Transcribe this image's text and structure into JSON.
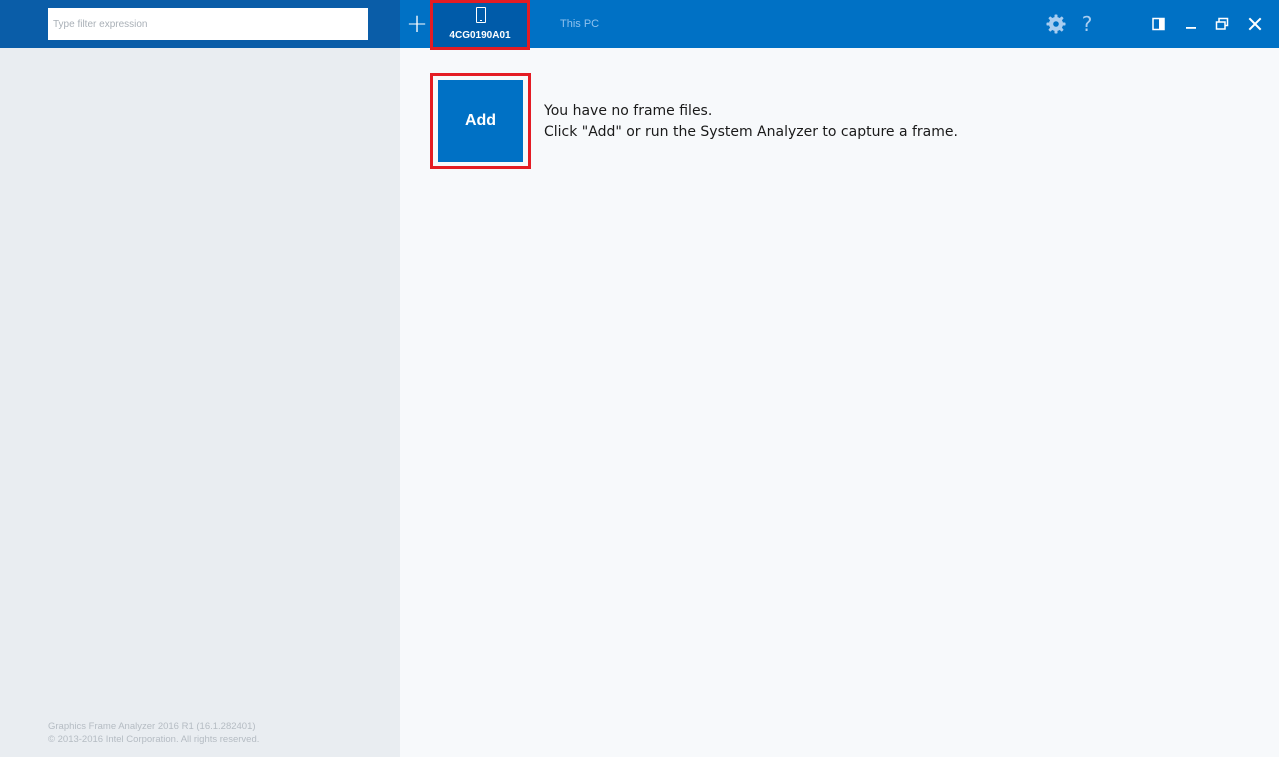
{
  "sidebar": {
    "filter_placeholder": "Type filter expression",
    "footer": {
      "version": "Graphics Frame Analyzer 2016 R1 (16.1.282401)",
      "copyright": "© 2013-2016 Intel Corporation. All rights reserved."
    }
  },
  "header": {
    "add_tab_label": "+",
    "tabs": [
      {
        "label": "4CG0190A01",
        "icon": "phone-icon",
        "selected": true
      },
      {
        "label": "This PC",
        "selected": false
      }
    ],
    "icons": [
      "gear-icon",
      "help-icon",
      "panel-toggle-icon",
      "minimize-icon",
      "restore-icon",
      "close-icon"
    ],
    "help_label": "?"
  },
  "main": {
    "add_button_label": "Add",
    "empty_message": {
      "line1": "You have no frame files.",
      "line2": "Click \"Add\" or run the System Analyzer to capture a frame."
    }
  },
  "colors": {
    "accent": "#0071c5",
    "sidebar_header": "#0a5da8",
    "highlight": "#e41c24",
    "sidebar_bg": "#e9edf1",
    "content_bg": "#f7f9fb"
  }
}
